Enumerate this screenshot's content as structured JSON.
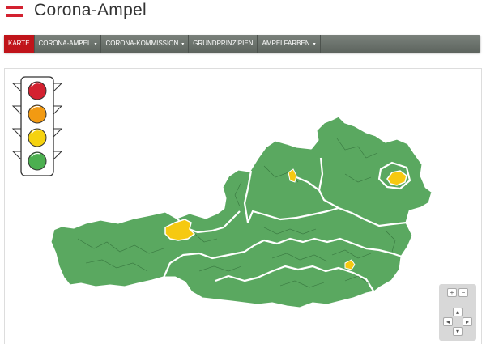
{
  "app": {
    "title": "Corona-Ampel"
  },
  "nav": [
    {
      "label": "KARTE",
      "active": true,
      "dropdown": false
    },
    {
      "label": "CORONA-AMPEL",
      "active": false,
      "dropdown": true
    },
    {
      "label": "CORONA-KOMMISSION",
      "active": false,
      "dropdown": true
    },
    {
      "label": "GRUNDPRINZIPIEN",
      "active": false,
      "dropdown": false
    },
    {
      "label": "AMPELFARBEN",
      "active": false,
      "dropdown": true
    }
  ],
  "colors": {
    "brand_red": "#c0141a",
    "light_red": "#d32130",
    "light_orange": "#f29a12",
    "light_yellow": "#f5d20f",
    "light_green": "#4caf50",
    "map_green": "#5aa860",
    "map_yellow": "#f6c911"
  },
  "map_controls": {
    "zoom_in_icon": "plus-icon",
    "zoom_out_icon": "minus-icon",
    "pan_icons": [
      "arrow-up-icon",
      "arrow-left-icon",
      "arrow-right-icon",
      "arrow-down-icon"
    ]
  }
}
